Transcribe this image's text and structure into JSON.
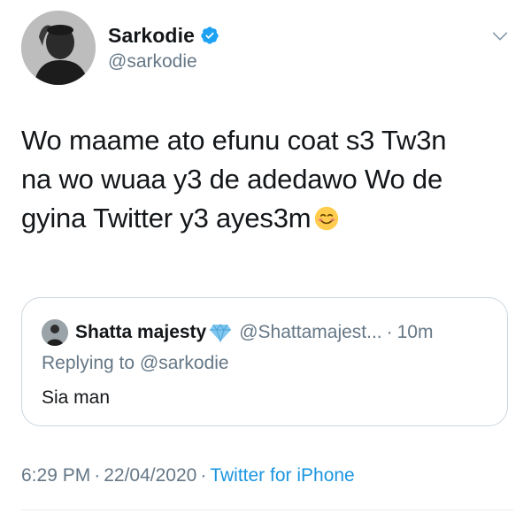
{
  "author": {
    "display_name": "Sarkodie",
    "handle": "@sarkodie",
    "verified": true,
    "avatar_icon": "profile-photo"
  },
  "tweet": {
    "text_line1": "Wo maame ato efunu coat s3 Tw3n",
    "text_line2": "na wo wuaa y3 de adedawo Wo de",
    "text_line3": "gyina Twitter y3 ayes3m",
    "emoji": "smiling-face-icon"
  },
  "quoted": {
    "display_name": "Shatta majesty",
    "name_emoji": "gem-icon",
    "handle": "@Shattamajest...",
    "separator": "·",
    "time": "10m",
    "replying_to": "Replying to @sarkodie",
    "text": "Sia man"
  },
  "meta": {
    "time": "6:29 PM",
    "separator": "·",
    "date": "22/04/2020",
    "source": "Twitter for iPhone"
  },
  "colors": {
    "text_primary": "#14171a",
    "text_secondary": "#657786",
    "link": "#1b95e0",
    "verified": "#1da1f2",
    "border": "#ccd6dd"
  }
}
